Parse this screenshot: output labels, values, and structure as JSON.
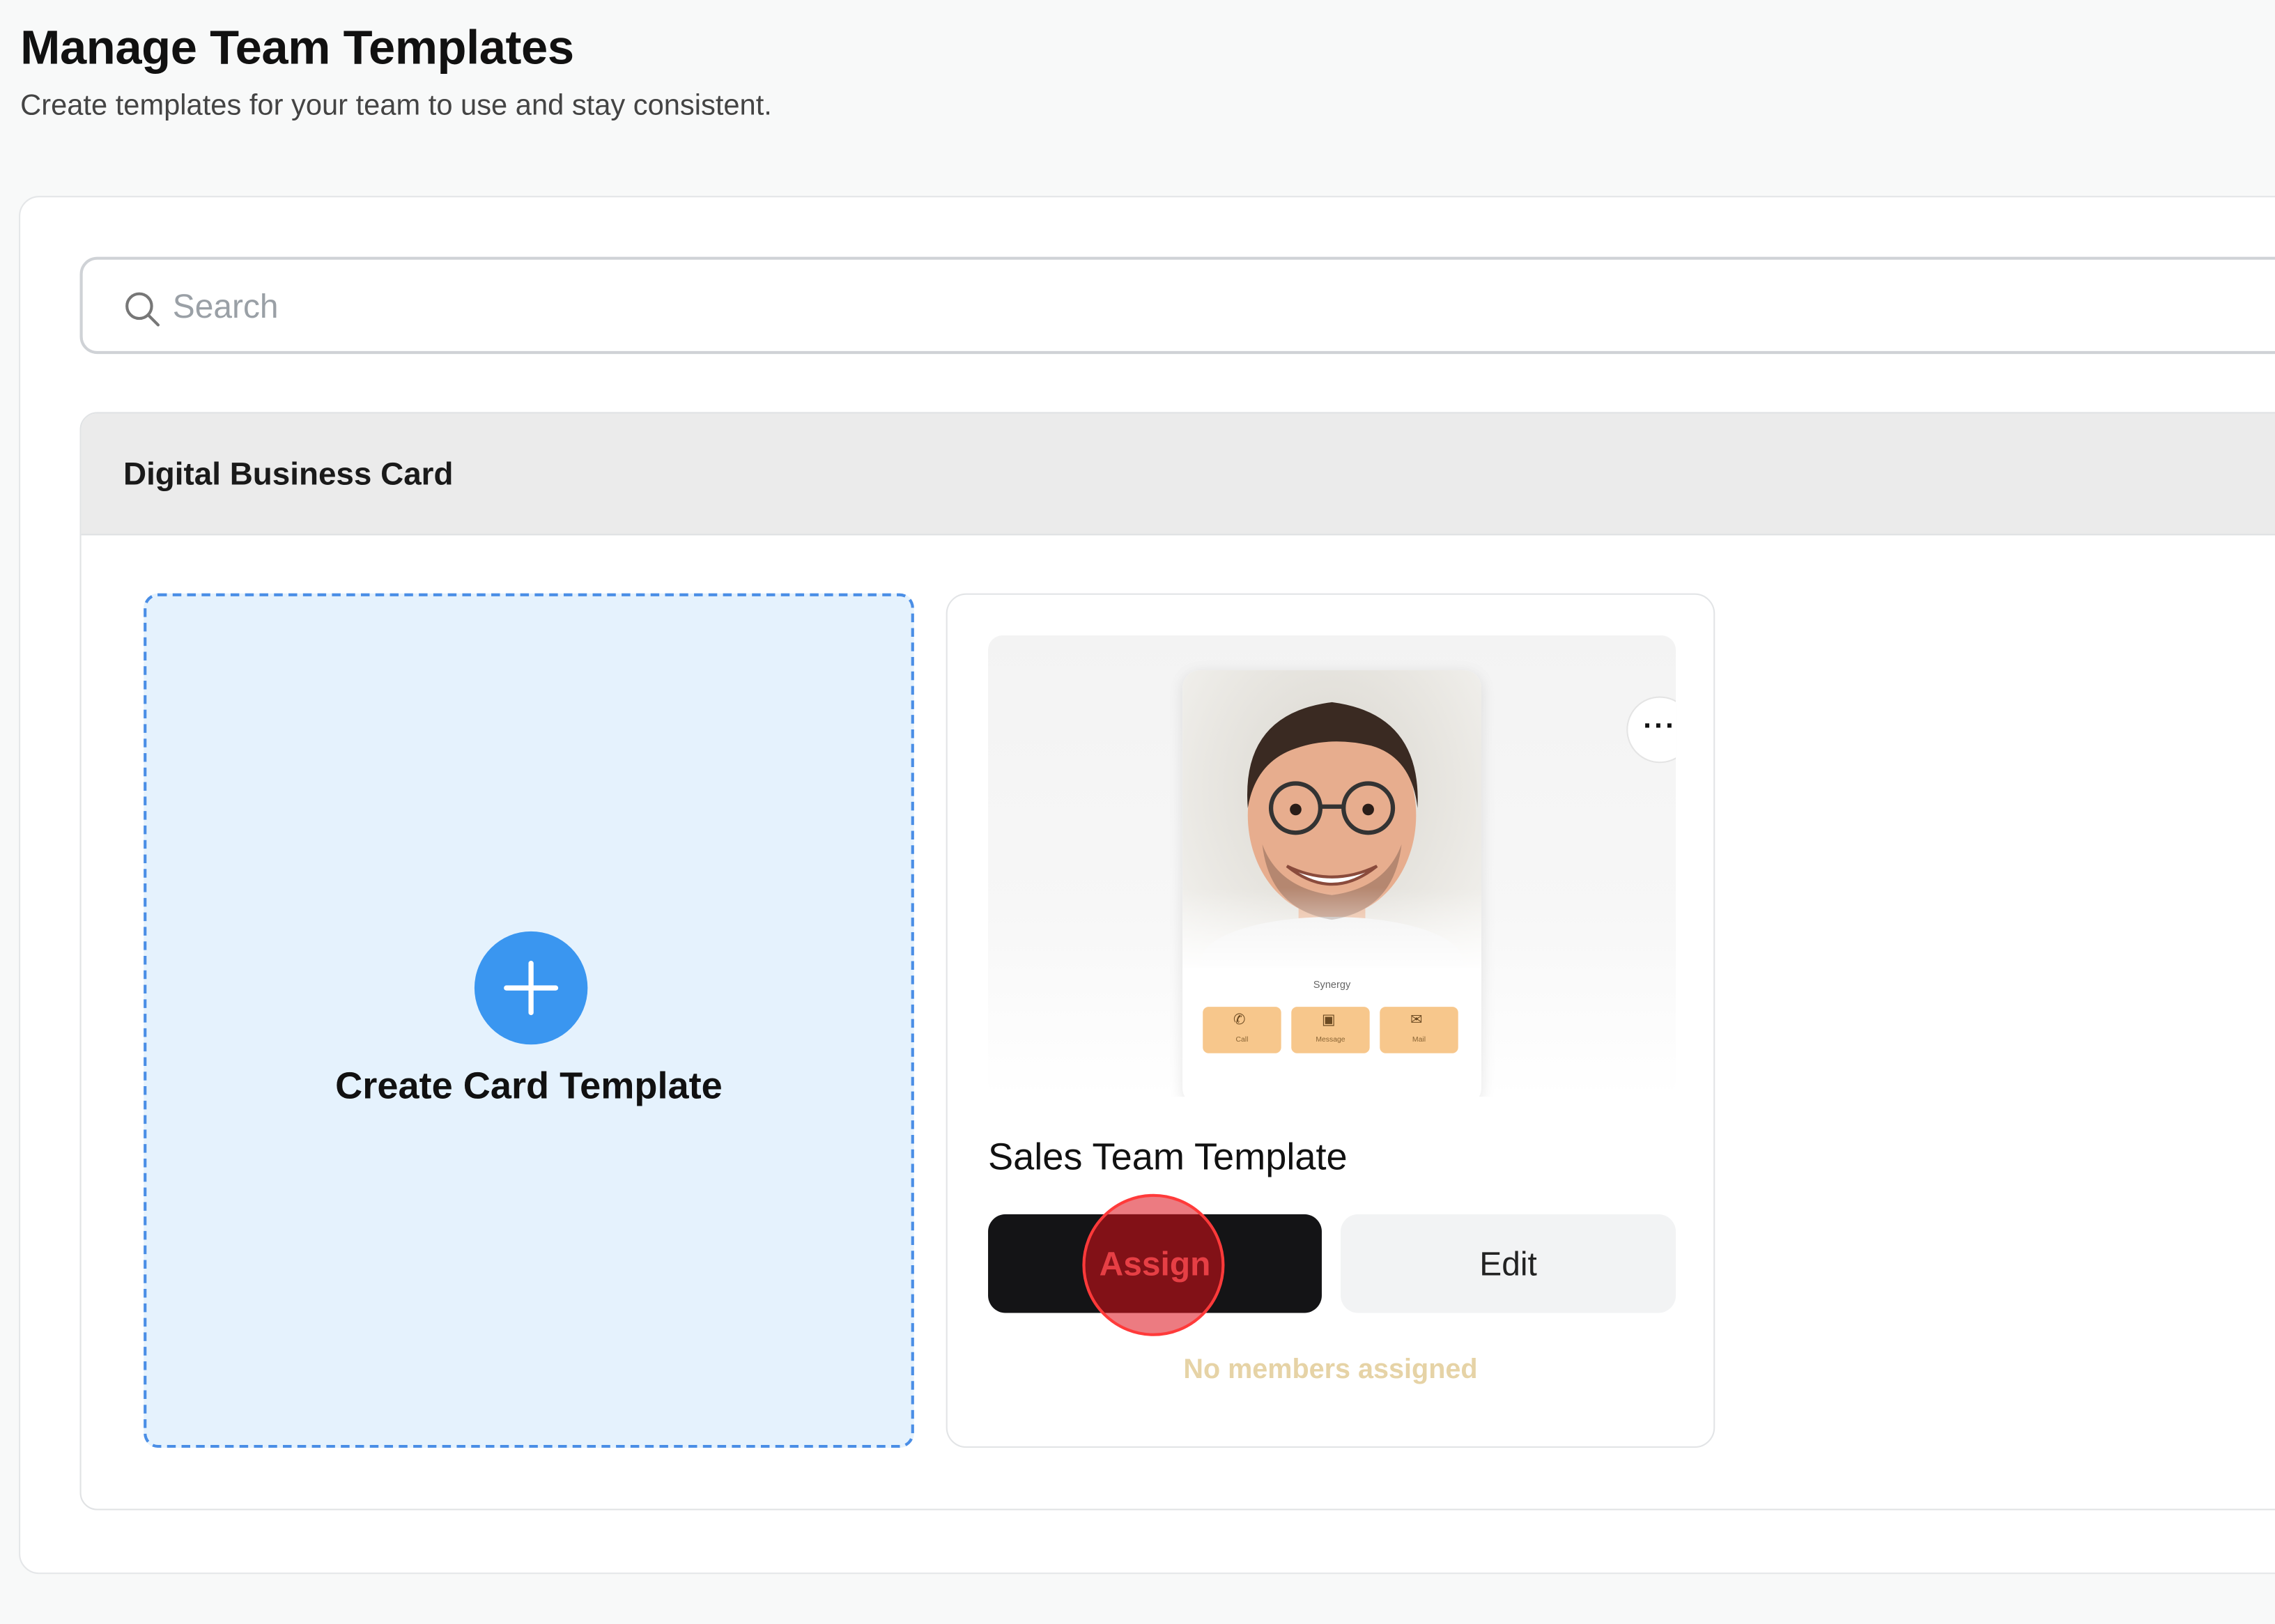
{
  "header": {
    "title": "Manage Team Templates",
    "subtitle": "Create templates for your team to use and stay consistent."
  },
  "search": {
    "placeholder": "Search",
    "value": ""
  },
  "section": {
    "title": "Digital Business Card"
  },
  "create_card": {
    "label": "Create Card Template",
    "icon": "plus-icon"
  },
  "template": {
    "name": "Sales Team Template",
    "assign_label": "Assign",
    "edit_label": "Edit",
    "members_status": "No members assigned",
    "more_icon": "more-dots-icon",
    "preview": {
      "company": "Synergy",
      "contacts": [
        {
          "label": "Call",
          "icon": "phone-icon"
        },
        {
          "label": "Message",
          "icon": "message-icon"
        },
        {
          "label": "Mail",
          "icon": "mail-icon"
        }
      ]
    }
  },
  "colors": {
    "accent_blue": "#3a96f0",
    "create_bg": "#e5f2fd",
    "assign_bg": "#141416",
    "contact_btn": "#f7c78c",
    "members_status": "#e6d3a6"
  }
}
